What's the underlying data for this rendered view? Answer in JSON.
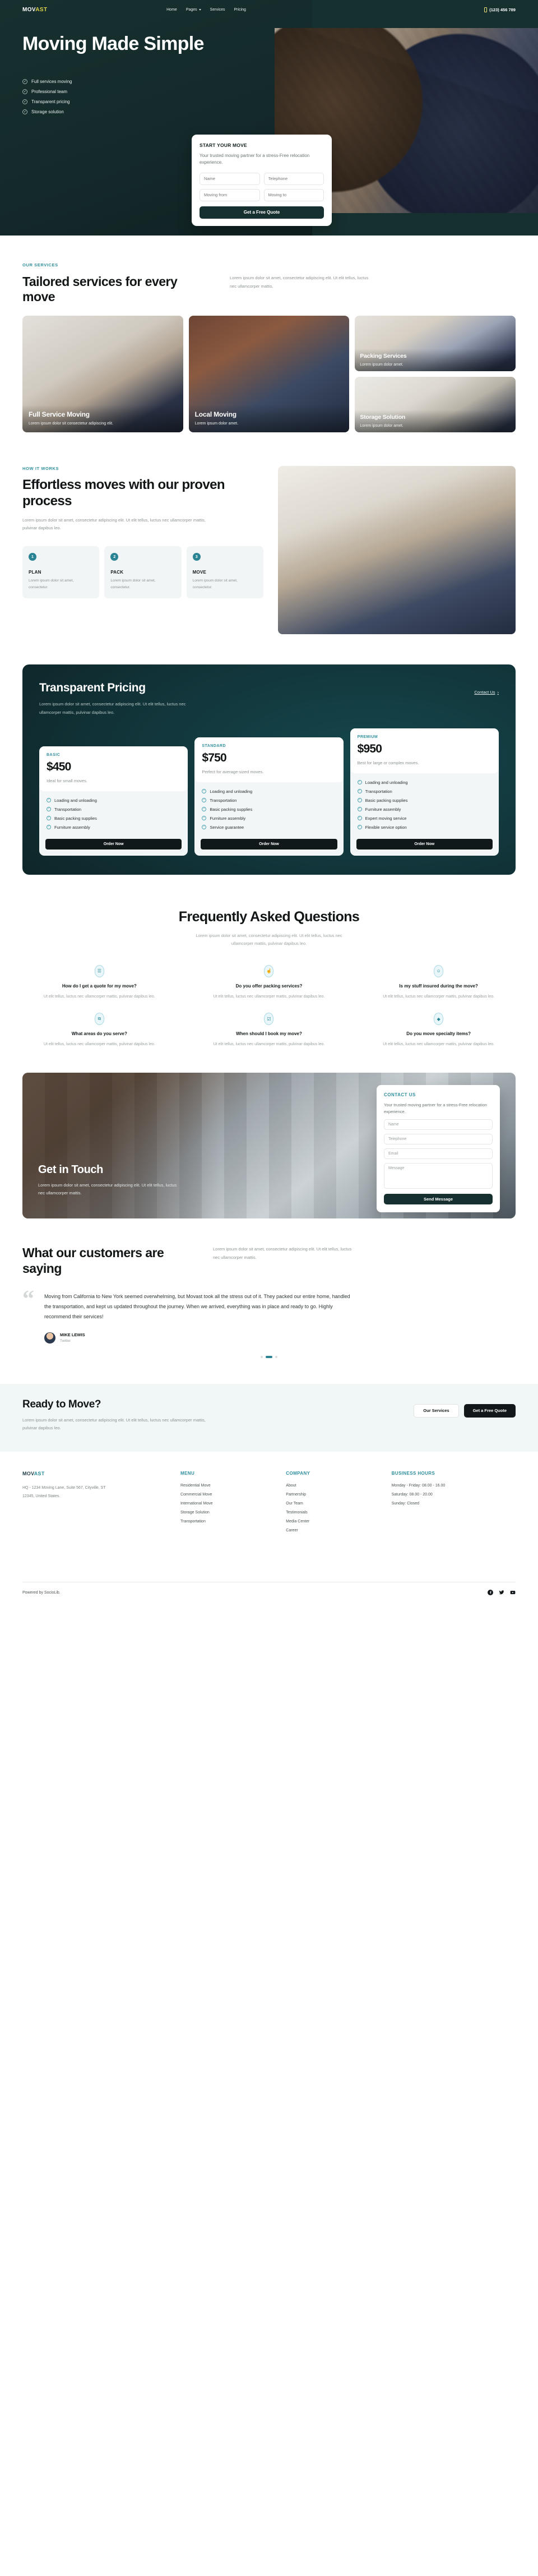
{
  "brand": {
    "name_part1": "MOV",
    "name_part2": "AST",
    "full": "MOVAST"
  },
  "nav": {
    "items": [
      {
        "label": "Home",
        "has_caret": false
      },
      {
        "label": "Pages",
        "has_caret": true
      },
      {
        "label": "Services",
        "has_caret": false
      },
      {
        "label": "Pricing",
        "has_caret": false
      }
    ],
    "phone": "(123) 456 789",
    "phone_icon": "mobile-phone-icon"
  },
  "hero": {
    "title": "Moving Made Simple",
    "features": [
      "Full services moving",
      "Professional team",
      "Transparent pricing",
      "Storage solution"
    ],
    "check_icon": "check-circle-icon",
    "form": {
      "title": "START YOUR MOVE",
      "subtitle": "Your trusted moving partner for a stress-Free relocation experience.",
      "fields": [
        {
          "name": "name",
          "placeholder": "Name"
        },
        {
          "name": "telephone",
          "placeholder": "Telephone"
        },
        {
          "name": "moving-from",
          "placeholder": "Moving from"
        },
        {
          "name": "moving-to",
          "placeholder": "Moving to"
        }
      ],
      "submit": "Get a Free Quote"
    }
  },
  "services": {
    "eyebrow": "OUR SERVICES",
    "title": "Tailored services for every move",
    "description": "Lorem ipsum dolor sit amet, consectetur adipiscing elit. Ut elit tellus, luctus nec ullamcorper mattis.",
    "cards": [
      {
        "name": "Full Service Moving",
        "desc": "Lorem ipsum dolor sit consectetur adipiscing elit."
      },
      {
        "name": "Local Moving",
        "desc": "Lorem ipsum dolor amet."
      },
      {
        "name": "Packing Services",
        "desc": "Lorem ipsum dolor amet."
      },
      {
        "name": "Storage Solution",
        "desc": "Lorem ipsum dolor amet."
      }
    ]
  },
  "how": {
    "eyebrow": "HOW IT WORKS",
    "title": "Effortless moves with our proven process",
    "description": "Lorem ipsum dolor sit amet, consectetur adipiscing elit. Ut elit tellus, luctus nec ullamcorper mattis, pulvinar dapibus leo.",
    "steps": [
      {
        "number": "1",
        "title": "PLAN",
        "desc": "Lorem ipsum dolor sit amet, consectetur."
      },
      {
        "number": "2",
        "title": "PACK",
        "desc": "Lorem ipsum dolor sit amet, consectetur."
      },
      {
        "number": "3",
        "title": "MOVE",
        "desc": "Lorem ipsum dolor sit amet, consectetur."
      }
    ]
  },
  "pricing": {
    "title": "Transparent Pricing",
    "contact_link": "Contact Us",
    "arrow_icon": "chevron-right-icon",
    "description": "Lorem ipsum dolor sit amet, consectetur adipiscing elit. Ut elit tellus, luctus nec ullamcorper mattis, pulvinar dapibus leo.",
    "plans": [
      {
        "tag": "BASIC",
        "price": "$450",
        "subtitle": "Ideal for small moves.",
        "features": [
          "Loading and unloading",
          "Transportation",
          "Basic packing supplies",
          "Furniture assembly"
        ],
        "cta": "Order Now"
      },
      {
        "tag": "STANDARD",
        "price": "$750",
        "subtitle": "Perfect for average-sized moves.",
        "features": [
          "Loading and unloading",
          "Transportation",
          "Basic packing supplies",
          "Furniture assembly",
          "Service guarantee"
        ],
        "cta": "Order Now"
      },
      {
        "tag": "PREMIUM",
        "price": "$950",
        "subtitle": "Best for large or complex moves.",
        "features": [
          "Loading and unloading",
          "Transportation",
          "Basic packing supplies",
          "Furniture assembly",
          "Expert moving service",
          "Flexible service option"
        ],
        "cta": "Order Now"
      }
    ]
  },
  "faq": {
    "title": "Frequently Asked Questions",
    "description": "Lorem ipsum dolor sit amet, consectetur adipiscing elit. Ut elit tellus, luctus nec ullamcorper mattis, pulvinar dapibus leo.",
    "items": [
      {
        "icon": "document-icon",
        "glyph": "☰",
        "question": "How do I get a quote for my move?",
        "answer": "Ut elit tellus, luctus nec ullamcorper mattis, pulvinar dapibus leo."
      },
      {
        "icon": "thumbs-up-icon",
        "glyph": "☝",
        "question": "Do you offer packing services?",
        "answer": "Ut elit tellus, luctus nec ullamcorper mattis, pulvinar dapibus leo."
      },
      {
        "icon": "smiley-icon",
        "glyph": "☺",
        "question": "Is my stuff insured during the move?",
        "answer": "Ut elit tellus, luctus nec ullamcorper mattis, pulvinar dapibus leo."
      },
      {
        "icon": "map-icon",
        "glyph": "⧉",
        "question": "What areas do you serve?",
        "answer": "Ut elit tellus, luctus nec ullamcorper mattis, pulvinar dapibus leo."
      },
      {
        "icon": "calendar-check-icon",
        "glyph": "☑",
        "question": "When should I book my move?",
        "answer": "Ut elit tellus, luctus nec ullamcorper mattis, pulvinar dapibus leo."
      },
      {
        "icon": "diamond-icon",
        "glyph": "◆",
        "question": "Do you move specialty items?",
        "answer": "Ut elit tellus, luctus nec ullamcorper mattis, pulvinar dapibus leo."
      }
    ]
  },
  "contact": {
    "title": "Get in Touch",
    "description": "Lorem ipsum dolor sit amet, consectetur adipiscing elit. Ut elit tellus, luctus nec ullamcorper mattis.",
    "form": {
      "tag": "CONTACT US",
      "subtitle": "Your trusted moving partner for a stress-Free relocation experience.",
      "fields": [
        {
          "name": "name",
          "placeholder": "Name"
        },
        {
          "name": "telephone",
          "placeholder": "Telephone"
        },
        {
          "name": "email",
          "placeholder": "Email"
        },
        {
          "name": "message",
          "placeholder": "Message"
        }
      ],
      "submit": "Send Message"
    }
  },
  "testimonials": {
    "title": "What our customers are saying",
    "description": "Lorem ipsum dolor sit amet, consectetur adipiscing elit. Ut elit tellus, luctus nec ullamcorper mattis.",
    "quote_mark": "“",
    "quote": "Moving from California to New York seemed overwhelming, but Movast took all the stress out of it. They packed our entire home, handled the transportation, and kept us updated throughout the journey. When we arrived, everything was in place and ready to go. Highly recommend their services!",
    "author_name": "MIKE LEWIS",
    "author_role": "Twitter",
    "dots": 3,
    "active_dot": 1
  },
  "cta": {
    "title": "Ready to Move?",
    "description": "Lorem ipsum dolor sit amet, consectetur adipiscing elit. Ut elit tellus, luctus nec ullamcorper mattis, pulvinar dapibus leo.",
    "secondary_button": "Our Services",
    "primary_button": "Get a Free Quote"
  },
  "footer": {
    "address": "HQ - 1234 Moving Lane, Suite 567, Cityville, ST 12345, United States.",
    "columns": [
      {
        "title": "MENU",
        "items": [
          "Residential Move",
          "Commercial Move",
          "International Move",
          "Storage Solution",
          "Transportation"
        ]
      },
      {
        "title": "COMPANY",
        "items": [
          "About",
          "Partnership",
          "Our Team",
          "Testimonials",
          "Media Center",
          "Career"
        ]
      },
      {
        "title": "BUSINESS HOURS",
        "items": [
          "Monday - Friday: 08.00 - 16.00",
          "Saturday: 08.00 - 20.00",
          "Sunday: Closed"
        ]
      }
    ],
    "powered_by": "Powered by SocioLib.",
    "socials": [
      {
        "name": "facebook-icon",
        "glyph": "f"
      },
      {
        "name": "twitter-icon",
        "glyph": "✈"
      },
      {
        "name": "youtube-icon",
        "glyph": "▶"
      }
    ]
  },
  "colors": {
    "dark_green": "#16302f",
    "teal_accent": "#2f8f9e",
    "yellow_accent": "#d9d24a",
    "near_black": "#12181a",
    "light_bg": "#f1f6f6"
  }
}
